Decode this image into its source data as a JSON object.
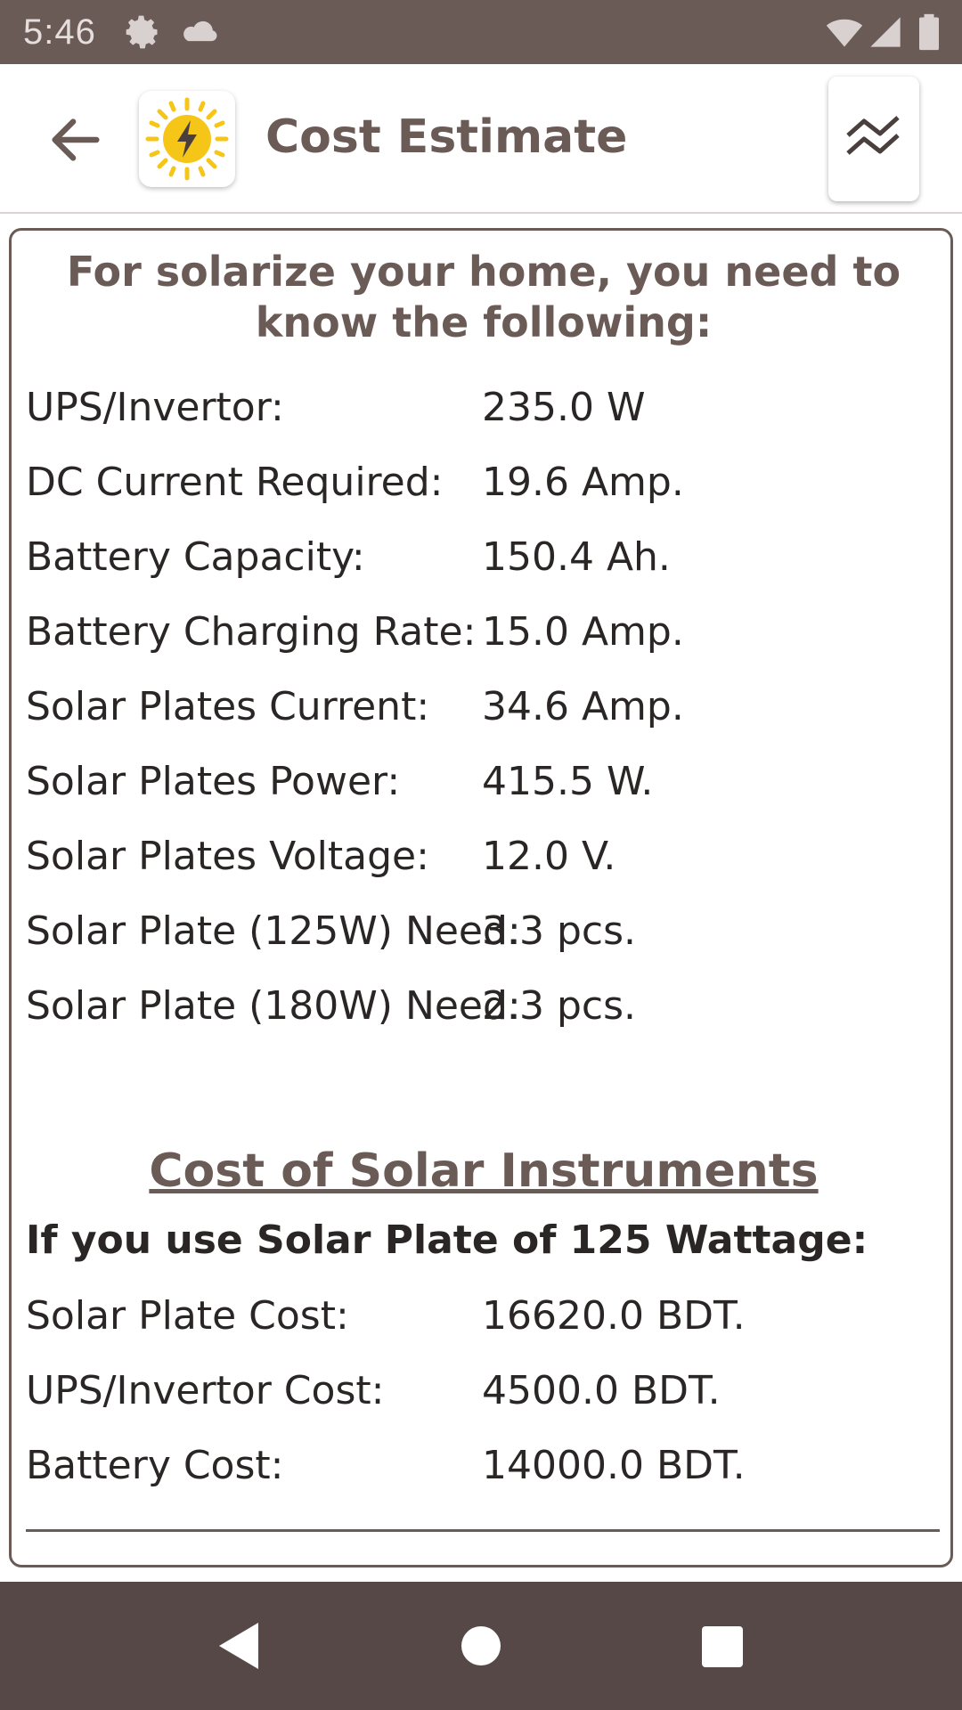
{
  "status_bar": {
    "time": "5:46",
    "icons": [
      "gear-icon",
      "cloud-icon",
      "wifi-icon",
      "signal-icon",
      "battery-icon"
    ]
  },
  "app_bar": {
    "title": "Cost Estimate",
    "back_icon": "arrow-left-icon",
    "logo_icon": "sun-bolt-icon",
    "action_icon": "chart-line-icon"
  },
  "intro": {
    "heading": "For solarize your home, you need to know the following:"
  },
  "requirements": [
    {
      "label": "UPS/Invertor:",
      "value": "235.0 W"
    },
    {
      "label": "DC Current Required:",
      "value": "19.6 Amp."
    },
    {
      "label": "Battery Capacity:",
      "value": "150.4 Ah."
    },
    {
      "label": "Battery Charging Rate:",
      "value": "15.0 Amp."
    },
    {
      "label": "Solar Plates Current:",
      "value": "34.6 Amp."
    },
    {
      "label": "Solar Plates Power:",
      "value": "415.5 W."
    },
    {
      "label": "Solar Plates Voltage:",
      "value": "12.0 V."
    },
    {
      "label": "Solar Plate (125W) Need:",
      "value": "3.3 pcs."
    },
    {
      "label": "Solar Plate (180W) Need:",
      "value": "2.3 pcs."
    }
  ],
  "cost_section": {
    "title": "Cost of Solar Instruments",
    "subtitle": "If you use Solar Plate of 125 Wattage:",
    "items": [
      {
        "label": "Solar Plate Cost:",
        "value": "16620.0 BDT."
      },
      {
        "label": "UPS/Invertor Cost:",
        "value": "4500.0 BDT."
      },
      {
        "label": "Battery Cost:",
        "value": "14000.0 BDT."
      }
    ]
  },
  "nav_bar": {
    "icons": [
      "back-triangle-icon",
      "home-circle-icon",
      "recents-square-icon"
    ]
  },
  "colors": {
    "primary": "#6b5b57",
    "status_bar": "#6b5b57",
    "nav_bar": "#564846",
    "text": "#2b2626",
    "sun": "#f5c518"
  }
}
